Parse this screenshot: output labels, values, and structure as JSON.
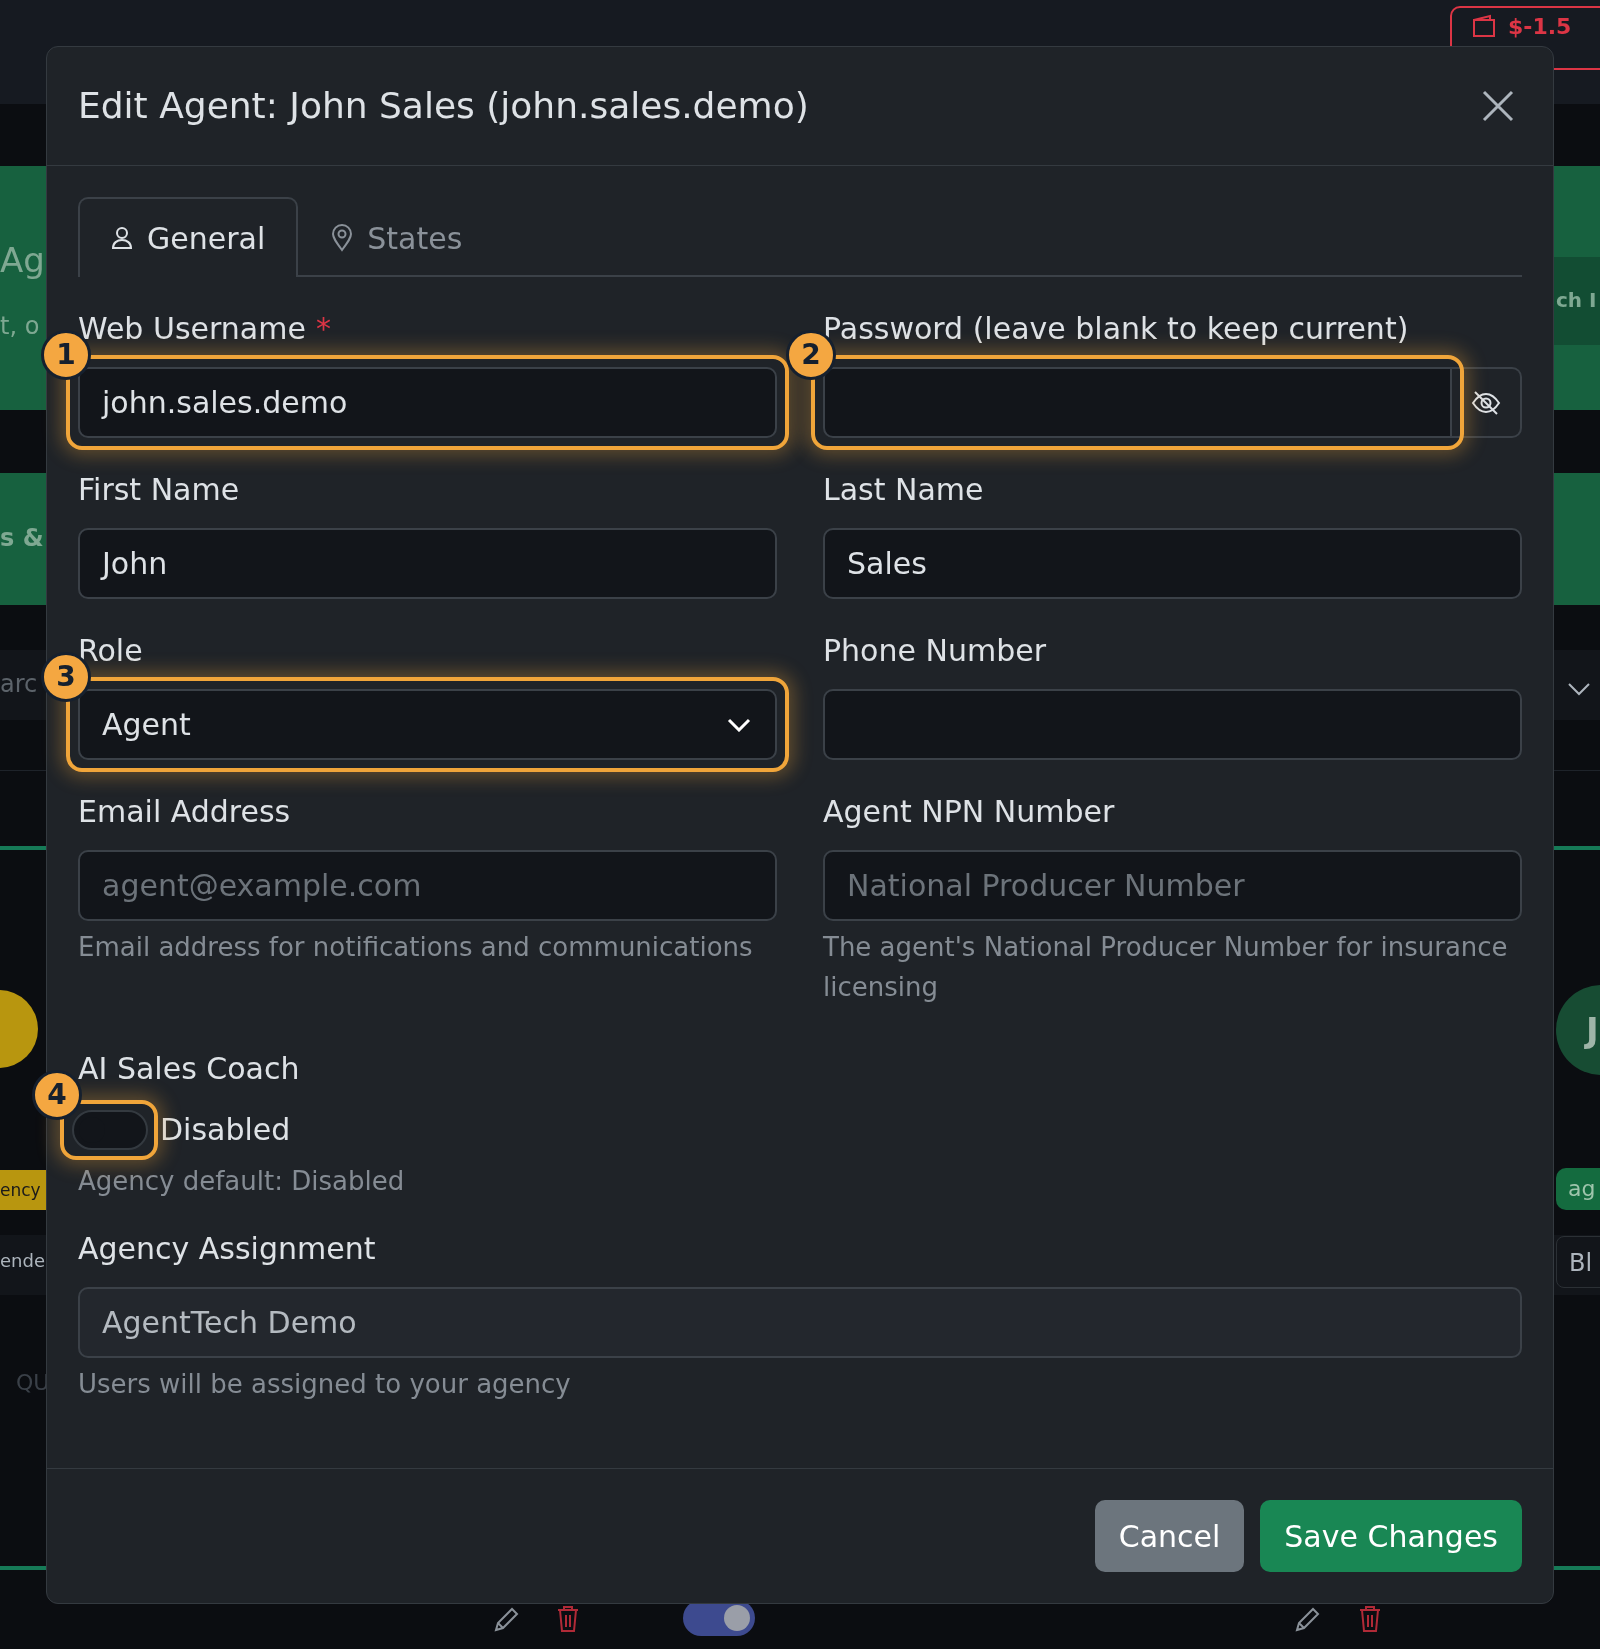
{
  "background": {
    "balance": "$-1.5",
    "left_fragments": [
      "Ag",
      "t, o",
      "s &",
      "arc",
      "ency",
      "ende",
      "QU"
    ],
    "right_fragments": [
      "ch I",
      "J",
      "ag",
      "Bl"
    ],
    "toggle_on": true
  },
  "modal": {
    "title": "Edit Agent: John Sales (john.sales.demo)",
    "tabs": [
      {
        "label": "General",
        "selected": true
      },
      {
        "label": "States",
        "selected": false
      }
    ],
    "fields": [
      {
        "kind": "input",
        "label": "Web Username",
        "required_mark": "*",
        "value": "john.sales.demo",
        "callout": "1"
      },
      {
        "kind": "password",
        "label": "Password (leave blank to keep current)",
        "callout": "2"
      },
      {
        "kind": "input",
        "label": "First Name",
        "value": "John"
      },
      {
        "kind": "input",
        "label": "Last Name",
        "value": "Sales"
      },
      {
        "kind": "select",
        "label": "Role",
        "value": "Agent",
        "callout": "3"
      },
      {
        "kind": "input",
        "label": "Phone Number"
      },
      {
        "kind": "input",
        "label": "Email Address",
        "placeholder": "agent@example.com",
        "help": "Email address for notifications and communications"
      },
      {
        "kind": "input",
        "label": "Agent NPN Number",
        "placeholder": "National Producer Number",
        "help": "The agent's National Producer Number for insurance licensing"
      }
    ],
    "coach": {
      "label": "AI Sales Coach",
      "on": false,
      "state_text": "Disabled",
      "help": "Agency default: Disabled",
      "callout": "4"
    },
    "agency": {
      "label": "Agency Assignment",
      "value": "AgentTech Demo",
      "disabled": true,
      "help": "Users will be assigned to your agency"
    },
    "buttons": [
      {
        "label": "Cancel",
        "kind": "secondary"
      },
      {
        "label": "Save Changes",
        "kind": "primary"
      }
    ]
  }
}
